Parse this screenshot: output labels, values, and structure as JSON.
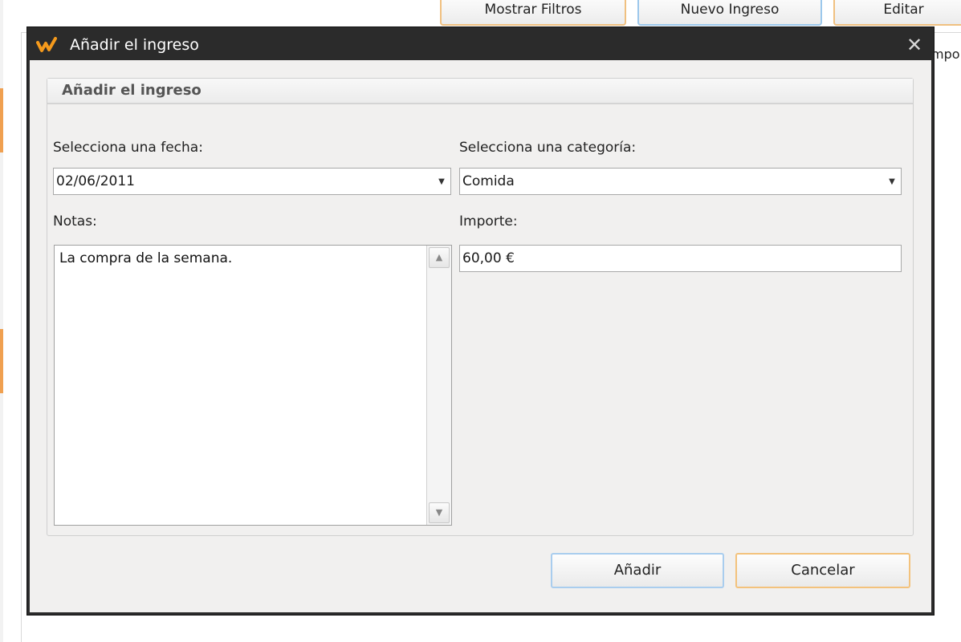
{
  "background": {
    "toolbar": {
      "show_filters_label": "Mostrar Filtros",
      "new_income_label": "Nuevo Ingreso",
      "edit_label": "Editar"
    },
    "table_header_partial": "mpo"
  },
  "dialog": {
    "title": "Añadir el ingreso",
    "close_glyph": "✕",
    "group_title": "Añadir el ingreso",
    "date": {
      "label": "Selecciona una fecha:",
      "value": "02/06/2011"
    },
    "category": {
      "label": "Selecciona una categoría:",
      "value": "Comida"
    },
    "notes": {
      "label": "Notas:",
      "value": "La compra de la semana."
    },
    "amount": {
      "label": "Importe:",
      "value": "60,00 €"
    },
    "add_label": "Añadir",
    "cancel_label": "Cancelar"
  },
  "icons": {
    "logo": "app-logo-icon",
    "dropdown": "chevron-down-icon",
    "scroll_up": "scroll-up-icon",
    "scroll_down": "scroll-down-icon"
  },
  "colors": {
    "accent_orange": "#f0a050",
    "accent_blue": "#9cc8ec",
    "titlebar": "#2b2b2b"
  }
}
